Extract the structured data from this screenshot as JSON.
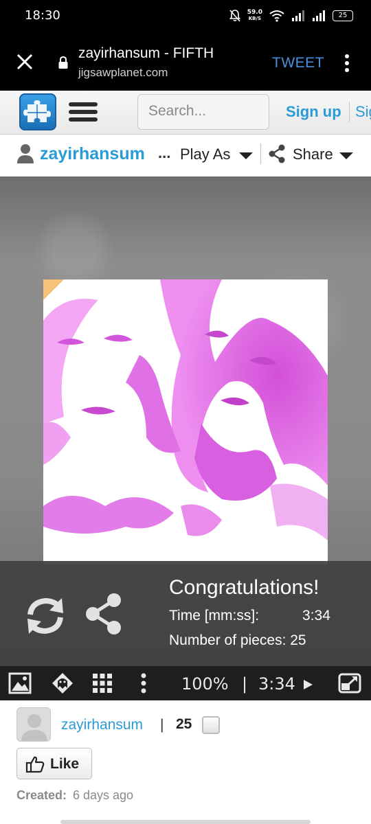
{
  "status_bar": {
    "time": "18:30",
    "net_speed_value": "59.0",
    "net_speed_unit": "KB/S",
    "battery": "25"
  },
  "browser": {
    "title": "zayirhansum - FIFTH",
    "url": "jigsawplanet.com",
    "tweet_label": "TWEET"
  },
  "site_header": {
    "search_placeholder": "Search...",
    "signup_label": "Sign up",
    "signin_label": "Sig"
  },
  "user_bar": {
    "username": "zayirhansum",
    "ellipsis": "...",
    "play_as_label": "Play As",
    "share_label": "Share"
  },
  "result": {
    "title": "Congratulations!",
    "time_label": "Time [mm:ss]:",
    "time_value": "3:34",
    "pieces_label": "Number of pieces: 25"
  },
  "toolbar": {
    "zoom": "100%",
    "separator": "|",
    "timer": "3:34"
  },
  "puzzle_info": {
    "author": "zayirhansum",
    "separator": "|",
    "pieces": "25",
    "like_label": "Like",
    "created_label": "Created:",
    "created_value": "6 days ago"
  },
  "colors": {
    "accent": "#2b9bd6",
    "tweet": "#4a90e2",
    "image_tint": "#e060e0"
  }
}
